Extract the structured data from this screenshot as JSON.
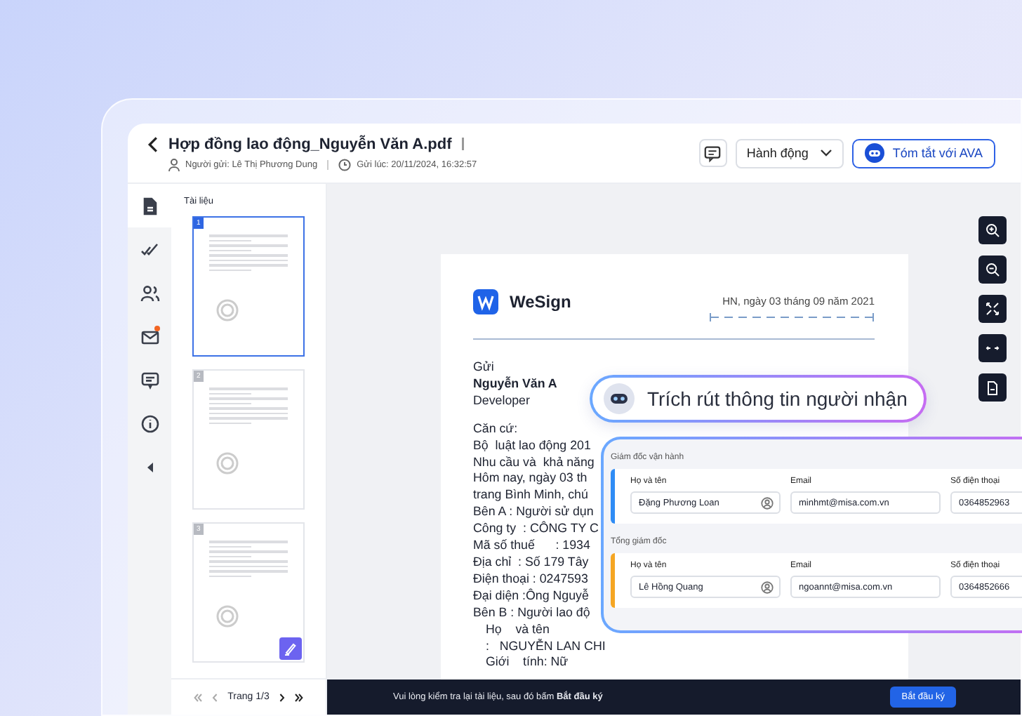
{
  "header": {
    "title": "Hợp đồng lao động_Nguyễn Văn A.pdf",
    "sender": "Người gửi: Lê Thị Phương Dung",
    "sent_at": "Gửi lúc: 20/11/2024, 16:32:57",
    "actions_label": "Hành động",
    "ava_button": "Tóm tắt với AVA"
  },
  "rail": [
    {
      "kind": "document",
      "selected": true,
      "badge": false
    },
    {
      "kind": "checks",
      "selected": false,
      "badge": false
    },
    {
      "kind": "people",
      "selected": false,
      "badge": false
    },
    {
      "kind": "mail",
      "selected": false,
      "badge": true
    },
    {
      "kind": "comment",
      "selected": false,
      "badge": false
    },
    {
      "kind": "info",
      "selected": false,
      "badge": false
    },
    {
      "kind": "collapse",
      "selected": false,
      "badge": false
    }
  ],
  "thumbnails": {
    "title": "Tài liệu",
    "pages": [
      {
        "number": "1",
        "selected": true,
        "sign_badge": false
      },
      {
        "number": "2",
        "selected": false,
        "sign_badge": false
      },
      {
        "number": "3",
        "selected": false,
        "sign_badge": true
      }
    ],
    "pager": "Trang 1/3"
  },
  "document": {
    "brand": "WeSign",
    "date": "HN, ngày 03 tháng 09 năm 2021",
    "lines": [
      {
        "kind": "plain",
        "text": "Gửi"
      },
      {
        "kind": "bold",
        "text": "Nguyễn Văn A"
      },
      {
        "kind": "plain",
        "text": "Developer"
      },
      {
        "kind": "spaced",
        "text": "Căn cứ:"
      },
      {
        "kind": "plain",
        "text": "Bộ  luật lao động 201"
      },
      {
        "kind": "plain",
        "text": "Nhu cầu và  khả năng"
      },
      {
        "kind": "plain",
        "text": "Hôm nay, ngày 03 th"
      },
      {
        "kind": "plain",
        "text": "trang Bình Minh, chú"
      },
      {
        "kind": "plain",
        "text": "Bên A : Người sử dụn"
      },
      {
        "kind": "plain",
        "text": "Công ty  : CÔNG TY C"
      },
      {
        "kind": "plain",
        "text": "Mã số thuế      : 1934"
      },
      {
        "kind": "plain",
        "text": "Địa chỉ  : Số 179 Tây"
      },
      {
        "kind": "plain",
        "text": "Điện thoại : 0247593"
      },
      {
        "kind": "plain",
        "text": "Đại diện :Ông Nguyễ"
      },
      {
        "kind": "plain",
        "text": "Bên B : Người lao độ"
      },
      {
        "kind": "indent",
        "text": "Họ    và tên"
      },
      {
        "kind": "indent",
        "text": ":   NGUYỄN LAN CHI"
      },
      {
        "kind": "indent",
        "text": "Giới    tính: Nữ"
      }
    ]
  },
  "extract": {
    "title": "Trích rút thông tin người nhận",
    "groups": [
      {
        "role": "Giám đốc vận hành",
        "color": "#2f8cf5",
        "fields": [
          {
            "kind": "name",
            "label": "Họ và tên",
            "value": "Đặng Phương Loan"
          },
          {
            "kind": "text",
            "label": "Email",
            "value": "minhmt@misa.com.vn"
          },
          {
            "kind": "text",
            "label": "Số điện thoại",
            "value": "0364852963"
          }
        ]
      },
      {
        "role": "Tổng giám đốc",
        "color": "#f5a623",
        "fields": [
          {
            "kind": "name",
            "label": "Họ và tên",
            "value": "Lê Hồng Quang"
          },
          {
            "kind": "text",
            "label": "Email",
            "value": "ngoannt@misa.com.vn"
          },
          {
            "kind": "text",
            "label": "Số điện thoại",
            "value": "0364852666"
          }
        ]
      }
    ]
  },
  "footer": {
    "message": "Vui lòng kiểm tra lại tài liệu, sau đó bấm **Bắt đầu ký**",
    "button": "Bắt đầu ký"
  }
}
